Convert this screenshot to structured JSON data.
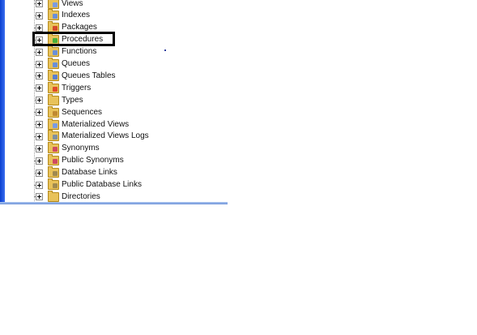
{
  "tree": {
    "items": [
      {
        "label": "Views",
        "icon": "views-folder-icon",
        "badge": "#7b9be0"
      },
      {
        "label": "Indexes",
        "icon": "indexes-folder-icon",
        "badge": "#6a8fd8"
      },
      {
        "label": "Packages",
        "icon": "packages-folder-icon",
        "badge": "#d44a2a"
      },
      {
        "label": "Procedures",
        "icon": "procedures-folder-icon",
        "badge": "#4caf3a"
      },
      {
        "label": "Functions",
        "icon": "functions-folder-icon",
        "badge": "#6a8fd8"
      },
      {
        "label": "Queues",
        "icon": "queues-folder-icon",
        "badge": "#6a8fd8"
      },
      {
        "label": "Queues Tables",
        "icon": "queues-tables-folder-icon",
        "badge": "#5a7fd0"
      },
      {
        "label": "Triggers",
        "icon": "triggers-folder-icon",
        "badge": "#e04a2a"
      },
      {
        "label": "Types",
        "icon": "types-folder-icon",
        "badge": "#e8c25a"
      },
      {
        "label": "Sequences",
        "icon": "sequences-folder-icon",
        "badge": "#c08a30"
      },
      {
        "label": "Materialized Views",
        "icon": "materialized-views-folder-icon",
        "badge": "#7b9be0"
      },
      {
        "label": "Materialized Views Logs",
        "icon": "materialized-views-logs-folder-icon",
        "badge": "#8090a0"
      },
      {
        "label": "Synonyms",
        "icon": "synonyms-folder-icon",
        "badge": "#d04a60"
      },
      {
        "label": "Public Synonyms",
        "icon": "public-synonyms-folder-icon",
        "badge": "#d04a60"
      },
      {
        "label": "Database Links",
        "icon": "database-links-folder-icon",
        "badge": "#a08a50"
      },
      {
        "label": "Public Database Links",
        "icon": "public-database-links-folder-icon",
        "badge": "#a08a50"
      },
      {
        "label": "Directories",
        "icon": "directories-folder-icon",
        "badge": "#e8c25a"
      }
    ]
  },
  "highlight": {
    "color": "#000000"
  }
}
